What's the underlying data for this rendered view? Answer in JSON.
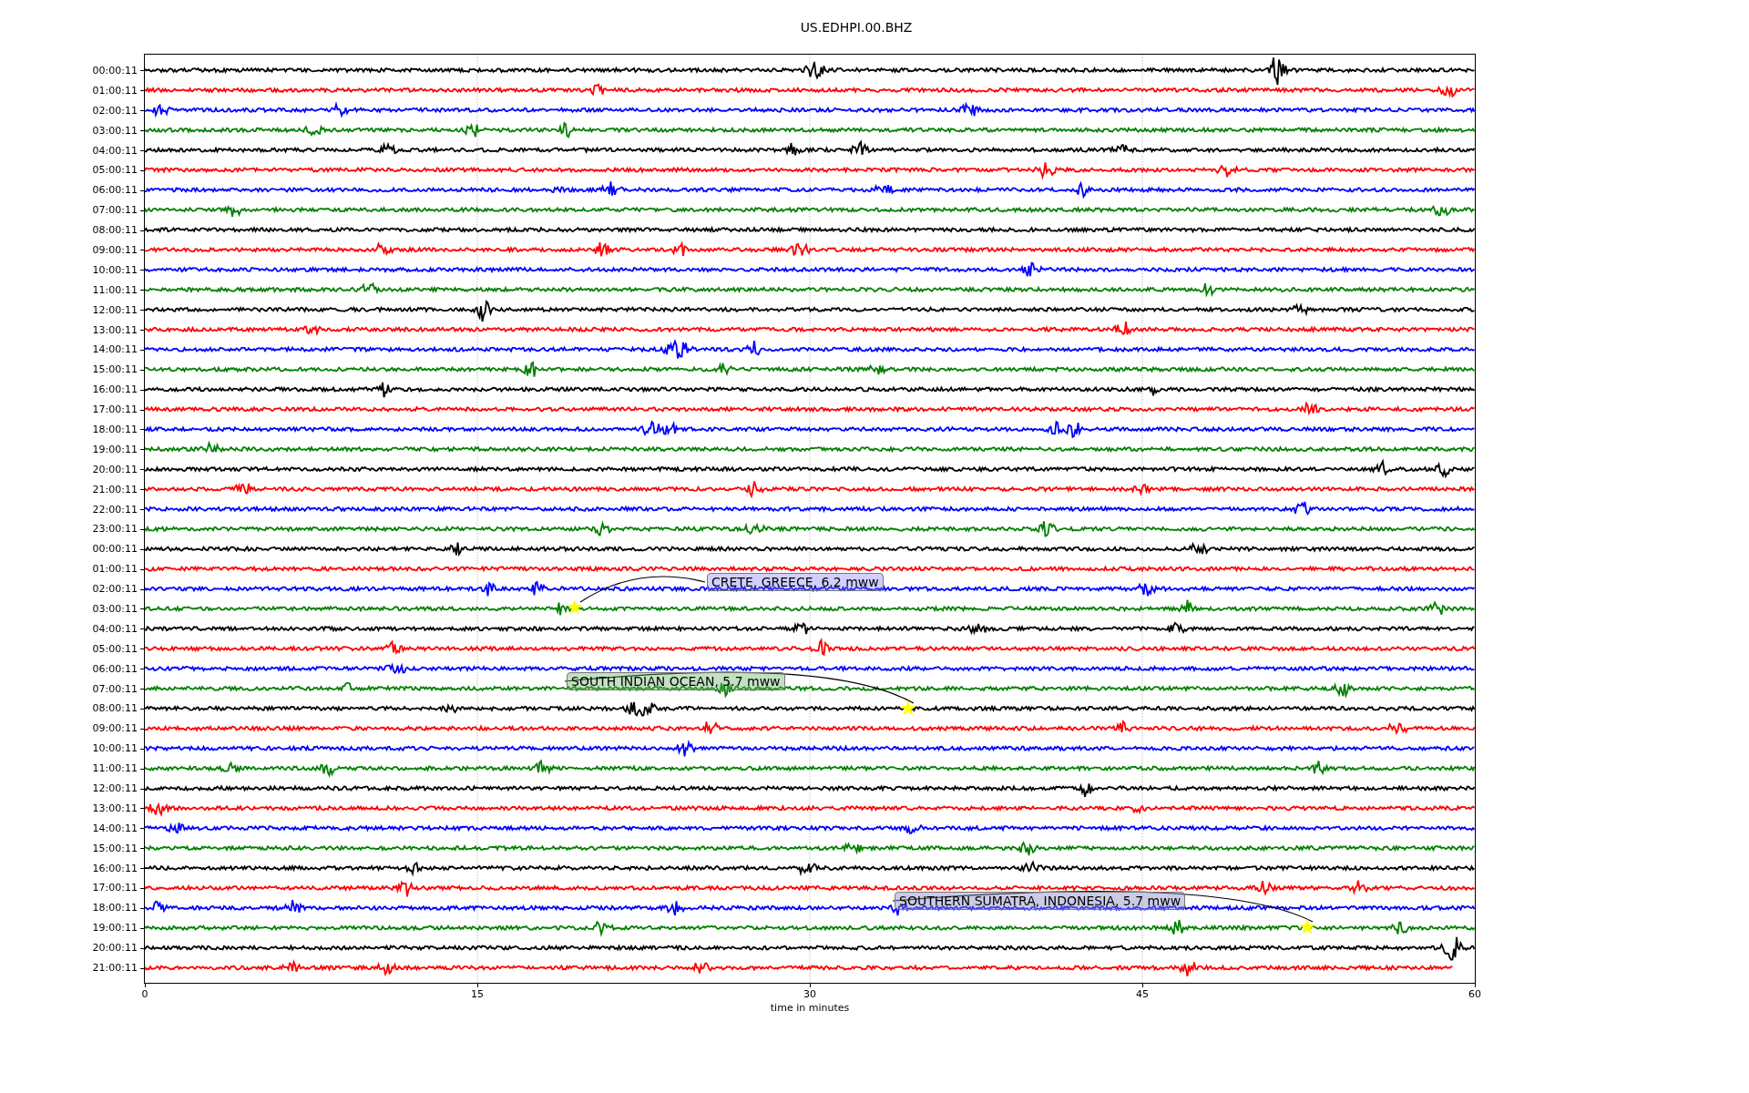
{
  "title": "US.EDHPI.00.BHZ",
  "rows": [
    {
      "label": "00:00:11",
      "color": "#000000"
    },
    {
      "label": "01:00:11",
      "color": "#ff0000"
    },
    {
      "label": "02:00:11",
      "color": "#0000ff"
    },
    {
      "label": "03:00:11",
      "color": "#008000"
    },
    {
      "label": "04:00:11",
      "color": "#000000"
    },
    {
      "label": "05:00:11",
      "color": "#ff0000"
    },
    {
      "label": "06:00:11",
      "color": "#0000ff"
    },
    {
      "label": "07:00:11",
      "color": "#008000"
    },
    {
      "label": "08:00:11",
      "color": "#000000"
    },
    {
      "label": "09:00:11",
      "color": "#ff0000"
    },
    {
      "label": "10:00:11",
      "color": "#0000ff"
    },
    {
      "label": "11:00:11",
      "color": "#008000"
    },
    {
      "label": "12:00:11",
      "color": "#000000"
    },
    {
      "label": "13:00:11",
      "color": "#ff0000"
    },
    {
      "label": "14:00:11",
      "color": "#0000ff"
    },
    {
      "label": "15:00:11",
      "color": "#008000"
    },
    {
      "label": "16:00:11",
      "color": "#000000"
    },
    {
      "label": "17:00:11",
      "color": "#ff0000"
    },
    {
      "label": "18:00:11",
      "color": "#0000ff"
    },
    {
      "label": "19:00:11",
      "color": "#008000"
    },
    {
      "label": "20:00:11",
      "color": "#000000"
    },
    {
      "label": "21:00:11",
      "color": "#ff0000"
    },
    {
      "label": "22:00:11",
      "color": "#0000ff"
    },
    {
      "label": "23:00:11",
      "color": "#008000"
    },
    {
      "label": "00:00:11",
      "color": "#000000"
    },
    {
      "label": "01:00:11",
      "color": "#ff0000"
    },
    {
      "label": "02:00:11",
      "color": "#0000ff"
    },
    {
      "label": "03:00:11",
      "color": "#008000"
    },
    {
      "label": "04:00:11",
      "color": "#000000"
    },
    {
      "label": "05:00:11",
      "color": "#ff0000"
    },
    {
      "label": "06:00:11",
      "color": "#0000ff"
    },
    {
      "label": "07:00:11",
      "color": "#008000"
    },
    {
      "label": "08:00:11",
      "color": "#000000"
    },
    {
      "label": "09:00:11",
      "color": "#ff0000"
    },
    {
      "label": "10:00:11",
      "color": "#0000ff"
    },
    {
      "label": "11:00:11",
      "color": "#008000"
    },
    {
      "label": "12:00:11",
      "color": "#000000"
    },
    {
      "label": "13:00:11",
      "color": "#ff0000"
    },
    {
      "label": "14:00:11",
      "color": "#0000ff"
    },
    {
      "label": "15:00:11",
      "color": "#008000"
    },
    {
      "label": "16:00:11",
      "color": "#000000"
    },
    {
      "label": "17:00:11",
      "color": "#ff0000"
    },
    {
      "label": "18:00:11",
      "color": "#0000ff"
    },
    {
      "label": "19:00:11",
      "color": "#008000"
    },
    {
      "label": "20:00:11",
      "color": "#000000"
    },
    {
      "label": "21:00:11",
      "color": "#ff0000"
    }
  ],
  "x_ticks": [
    "0",
    "15",
    "30",
    "45",
    "60"
  ],
  "xlabel": "time in minutes",
  "annotations": [
    {
      "text": "CRETE, GREECE, 6.2 mww"
    },
    {
      "text": "SOUTH INDIAN OCEAN, 5.7 mww"
    },
    {
      "text": "SOUTHERN SUMATRA, INDONESIA, 5.7 mww"
    }
  ]
}
